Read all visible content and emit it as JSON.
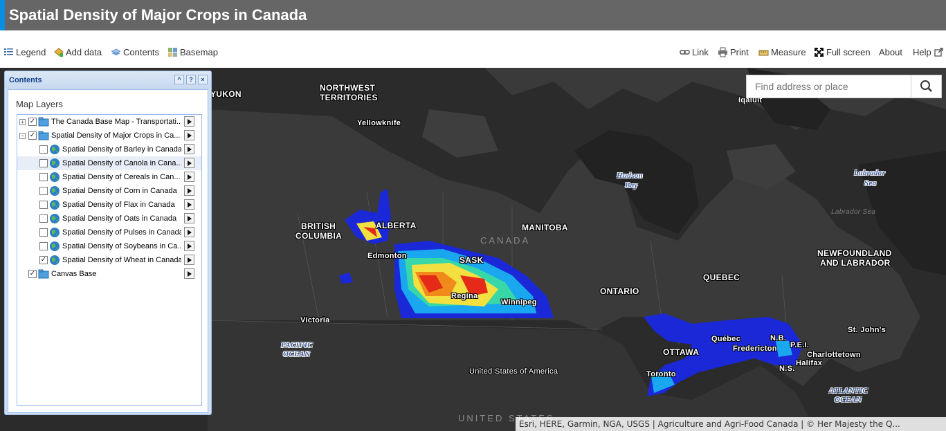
{
  "app": {
    "title": "Spatial Density of Major Crops in Canada",
    "accent": "#0a8fe0"
  },
  "toolbar": {
    "legend": "Legend",
    "add_data": "Add data",
    "contents": "Contents",
    "basemap": "Basemap",
    "link": "Link",
    "print": "Print",
    "measure": "Measure",
    "full_screen": "Full screen",
    "about": "About",
    "help": "Help"
  },
  "search": {
    "placeholder": "Find address or place"
  },
  "contents_panel": {
    "title": "Contents",
    "section": "Map Layers",
    "layers": [
      {
        "label": "The Canada Base Map - Transportati...",
        "checked": true,
        "level": 0,
        "expand": "+"
      },
      {
        "label": "Spatial Density of Major Crops in Ca...",
        "checked": true,
        "level": 0,
        "expand": "-"
      },
      {
        "label": "Spatial Density of Barley in Canada",
        "checked": false,
        "level": 1
      },
      {
        "label": "Spatial Density of Canola in Cana...",
        "checked": false,
        "level": 1,
        "selected": true
      },
      {
        "label": "Spatial Density of Cereals in Can...",
        "checked": false,
        "level": 1
      },
      {
        "label": "Spatial Density of Corn in Canada",
        "checked": false,
        "level": 1
      },
      {
        "label": "Spatial Density of Flax in Canada",
        "checked": false,
        "level": 1
      },
      {
        "label": "Spatial Density of Oats in Canada",
        "checked": false,
        "level": 1
      },
      {
        "label": "Spatial Density of Pulses in Canada",
        "checked": false,
        "level": 1
      },
      {
        "label": "Spatial Density of Soybeans in Ca...",
        "checked": false,
        "level": 1
      },
      {
        "label": "Spatial Density of Wheat in Canada",
        "checked": true,
        "level": 1
      },
      {
        "label": "Canvas Base",
        "checked": true,
        "level": 0
      }
    ]
  },
  "map": {
    "labels": {
      "yukon": "YUKON",
      "nwt1": "NORTHWEST",
      "nwt2": "TERRITORIES",
      "yellowknife": "Yellowknife",
      "iqaluit": "Iqaluit",
      "hudson1": "Hudson",
      "hudson2": "Bay",
      "labsea1": "Labrador",
      "labsea2": "Sea",
      "labsea_faint": "Labrador Sea",
      "bc1": "BRITISH",
      "bc2": "COLUMBIA",
      "alberta": "ALBERTA",
      "manitoba": "MANITOBA",
      "canada": "CANADA",
      "sask": "SASK",
      "edmonton": "Edmonton",
      "regina": "Regina",
      "winnipeg": "Winnipeg",
      "nfl1": "NEWFOUNDLAND",
      "nfl2": "AND LABRADOR",
      "quebec": "QUEBEC",
      "ontario": "ONTARIO",
      "victoria": "Victoria",
      "pacific1": "PACIFIC",
      "pacific2": "OCEAN",
      "ottawa": "OTTAWA",
      "quebec_city": "Québec",
      "fredericton": "Fredericton",
      "nb": "N.B.",
      "pei": "P.E.I.",
      "charlottetown": "Charlottetown",
      "halifax": "Halifax",
      "ns": "N.S.",
      "stjohns": "St. John's",
      "toronto": "Toronto",
      "usa": "United States of America",
      "us_faint": "UNITED STATES",
      "atlantic1": "ATLANTIC",
      "atlantic2": "OCEAN"
    },
    "attribution": "Esri, HERE, Garmin, NGA, USGS | Agriculture and Agri-Food Canada | © Her Majesty the Q..."
  }
}
